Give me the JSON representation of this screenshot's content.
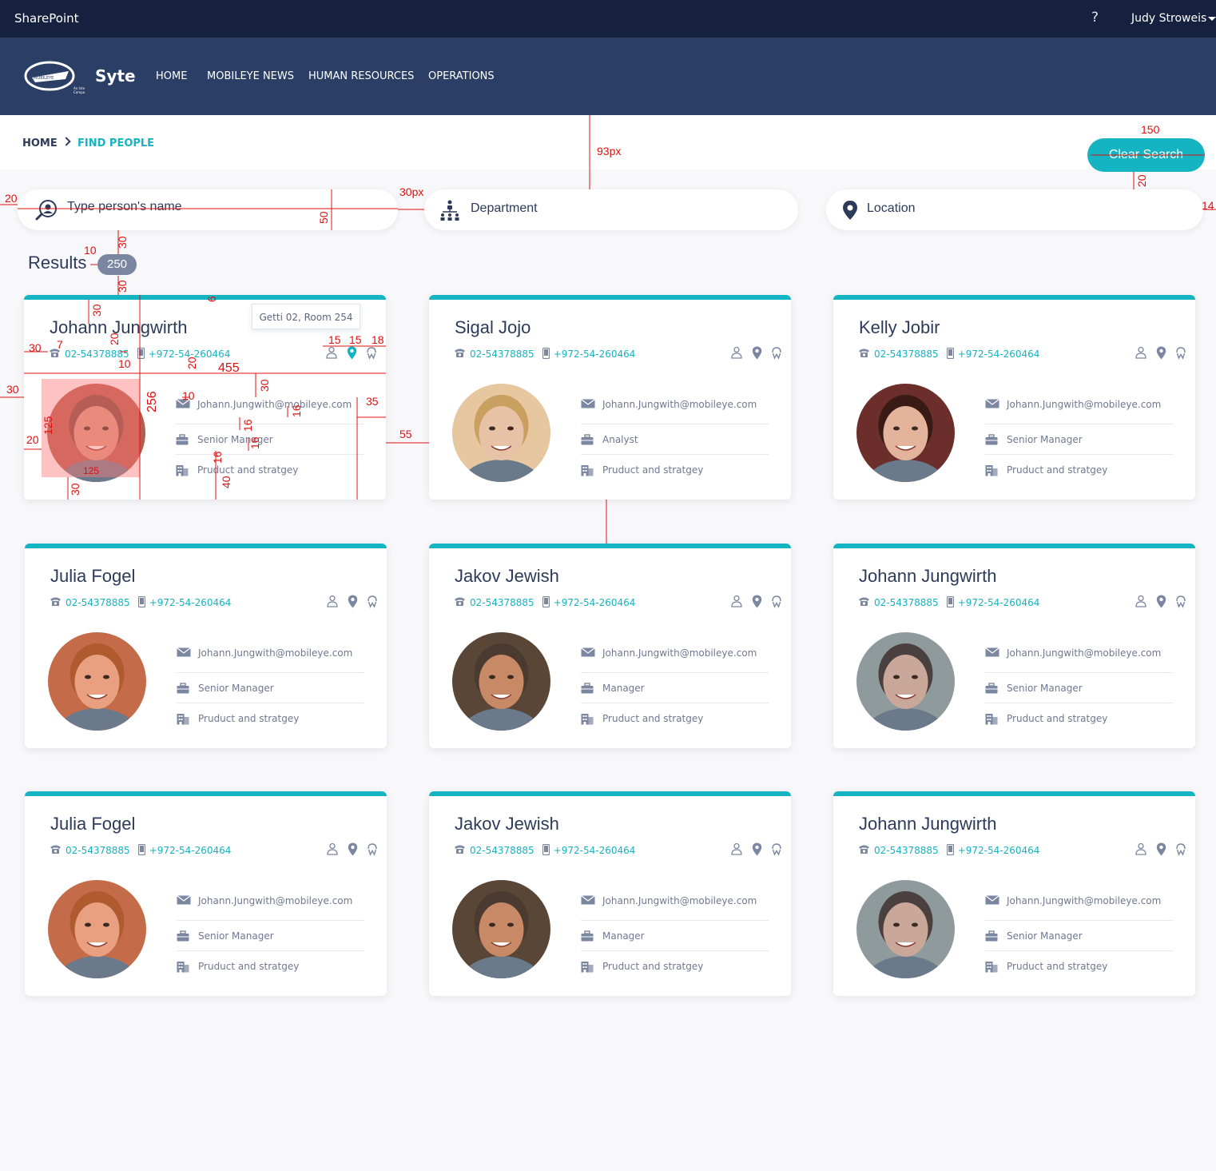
{
  "topbar": {
    "brand": "SharePoint",
    "help": "?",
    "user": "Judy Stroweis"
  },
  "site": {
    "name": "Syte",
    "logo": "mobileye-logo"
  },
  "nav": [
    "HOME",
    "MOBILEYE NEWS",
    "HUMAN RESOURCES",
    "OPERATIONS"
  ],
  "breadcrumb": {
    "home": "HOME",
    "current": "FIND PEOPLE"
  },
  "clear_search": "Clear Search",
  "search": {
    "name_placeholder": "Type person's name",
    "department": "Department",
    "location": "Location"
  },
  "results": {
    "label": "Results",
    "count": "250"
  },
  "tooltip": "Getti 02, Room 254",
  "colors": {
    "accent": "#14b4c2",
    "navy": "#15213f",
    "nav_bg": "#2b3e66",
    "annotation": "#e01010"
  },
  "icons": [
    "phone-icon",
    "mobile-icon",
    "org-chart-icon",
    "location-pin-icon",
    "whatsapp-icon",
    "envelope-icon",
    "briefcase-icon",
    "building-icon"
  ],
  "people": [
    {
      "name": "Johann Jungwirth",
      "phone": "02-54378885",
      "mobile": "+972-54-260464",
      "email": "Johann.Jungwith@mobileye.com",
      "title": "Senior Manager",
      "department": "Pruduct and stratgey"
    },
    {
      "name": "Sigal Jojo",
      "phone": "02-54378885",
      "mobile": "+972-54-260464",
      "email": "Johann.Jungwith@mobileye.com",
      "title": "Analyst",
      "department": "Pruduct and stratgey"
    },
    {
      "name": "Kelly Jobir",
      "phone": "02-54378885",
      "mobile": "+972-54-260464",
      "email": "Johann.Jungwith@mobileye.com",
      "title": "Senior Manager",
      "department": "Pruduct and stratgey"
    },
    {
      "name": "Julia Fogel",
      "phone": "02-54378885",
      "mobile": "+972-54-260464",
      "email": "Johann.Jungwith@mobileye.com",
      "title": "Senior Manager",
      "department": "Pruduct and stratgey"
    },
    {
      "name": "Jakov Jewish",
      "phone": "02-54378885",
      "mobile": "+972-54-260464",
      "email": "Johann.Jungwith@mobileye.com",
      "title": "Manager",
      "department": "Pruduct and stratgey"
    },
    {
      "name": "Johann Jungwirth",
      "phone": "02-54378885",
      "mobile": "+972-54-260464",
      "email": "Johann.Jungwith@mobileye.com",
      "title": "Senior Manager",
      "department": "Pruduct and stratgey"
    },
    {
      "name": "Julia Fogel",
      "phone": "02-54378885",
      "mobile": "+972-54-260464",
      "email": "Johann.Jungwith@mobileye.com",
      "title": "Senior Manager",
      "department": "Pruduct and stratgey"
    },
    {
      "name": "Jakov Jewish",
      "phone": "02-54378885",
      "mobile": "+972-54-260464",
      "email": "Johann.Jungwith@mobileye.com",
      "title": "Manager",
      "department": "Pruduct and stratgey"
    },
    {
      "name": "Johann Jungwirth",
      "phone": "02-54378885",
      "mobile": "+972-54-260464",
      "email": "Johann.Jungwith@mobileye.com",
      "title": "Senior Manager",
      "department": "Pruduct and stratgey"
    }
  ],
  "annotations": [
    "93px",
    "150",
    "20",
    "30px",
    "50",
    "14",
    "10",
    "30",
    "30",
    "30",
    "7",
    "20",
    "10",
    "20",
    "455",
    "30",
    "256",
    "10",
    "16",
    "35",
    "55",
    "125",
    "20",
    "16",
    "16",
    "40",
    "30",
    "15",
    "15",
    "18",
    "6",
    "125"
  ]
}
